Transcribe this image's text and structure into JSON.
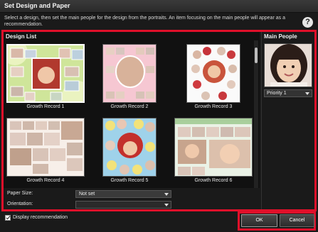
{
  "window": {
    "title": "Set Design and Paper"
  },
  "description": "Select a design, then set the main people for the design from the portraits. An item focusing on the main people will appear as a recommendation.",
  "help_icon": "?",
  "design_list": {
    "label": "Design List",
    "items": [
      {
        "label": "Growth Record 1",
        "selected": true
      },
      {
        "label": "Growth Record 2",
        "selected": false
      },
      {
        "label": "Growth Record 3",
        "selected": false
      },
      {
        "label": "Growth Record 4",
        "selected": false
      },
      {
        "label": "Growth Record 5",
        "selected": false
      },
      {
        "label": "Growth Record 6",
        "selected": false
      }
    ]
  },
  "settings": {
    "paper_size_label": "Paper Size:",
    "paper_size_value": "Not set",
    "orientation_label": "Orientation:",
    "orientation_value": ""
  },
  "main_people": {
    "label": "Main People",
    "priority_value": "Priority 1"
  },
  "footer": {
    "display_recommendation_label": "Display recommendation",
    "display_recommendation_checked": true,
    "ok_label": "OK",
    "cancel_label": "Cancel"
  },
  "colors": {
    "accent_highlight": "#e0102a",
    "background": "#1a1a1a"
  },
  "icons": [
    "help-icon",
    "dropdown-arrow-icon",
    "checkbox-checked-icon"
  ]
}
